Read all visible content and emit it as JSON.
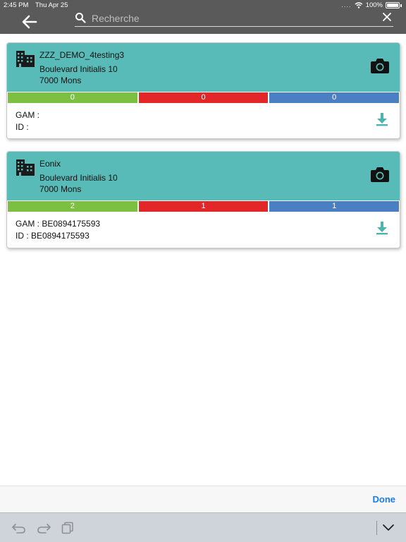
{
  "status_bar": {
    "time": "2:45 PM",
    "date": "Thu Apr 25",
    "signal": "....",
    "battery": "100%"
  },
  "header": {
    "back_icon": "arrow-left-icon",
    "search_icon": "search-icon",
    "search_placeholder": "Recherche",
    "search_value": "",
    "clear_icon": "close-icon"
  },
  "cards": [
    {
      "name": "ZZZ_DEMO_4testing3",
      "street": "Boulevard Initialis 10",
      "city": "7000 Mons",
      "counts": [
        "0",
        "0",
        "0"
      ],
      "gam": "GAM :",
      "id": "ID :"
    },
    {
      "name": "Eonix",
      "street": "Boulevard Initialis 10",
      "city": "7000 Mons",
      "counts": [
        "2",
        "1",
        "1"
      ],
      "gam": "GAM : BE0894175593",
      "id": "ID : BE0894175593"
    }
  ],
  "accessory": {
    "done_label": "Done"
  },
  "colors": {
    "chrome": "#5a5a5a",
    "card_header": "#58bbb7",
    "green": "#7cc042",
    "red": "#e32627",
    "blue": "#4a7fc4",
    "accent": "#1a7cf5"
  }
}
